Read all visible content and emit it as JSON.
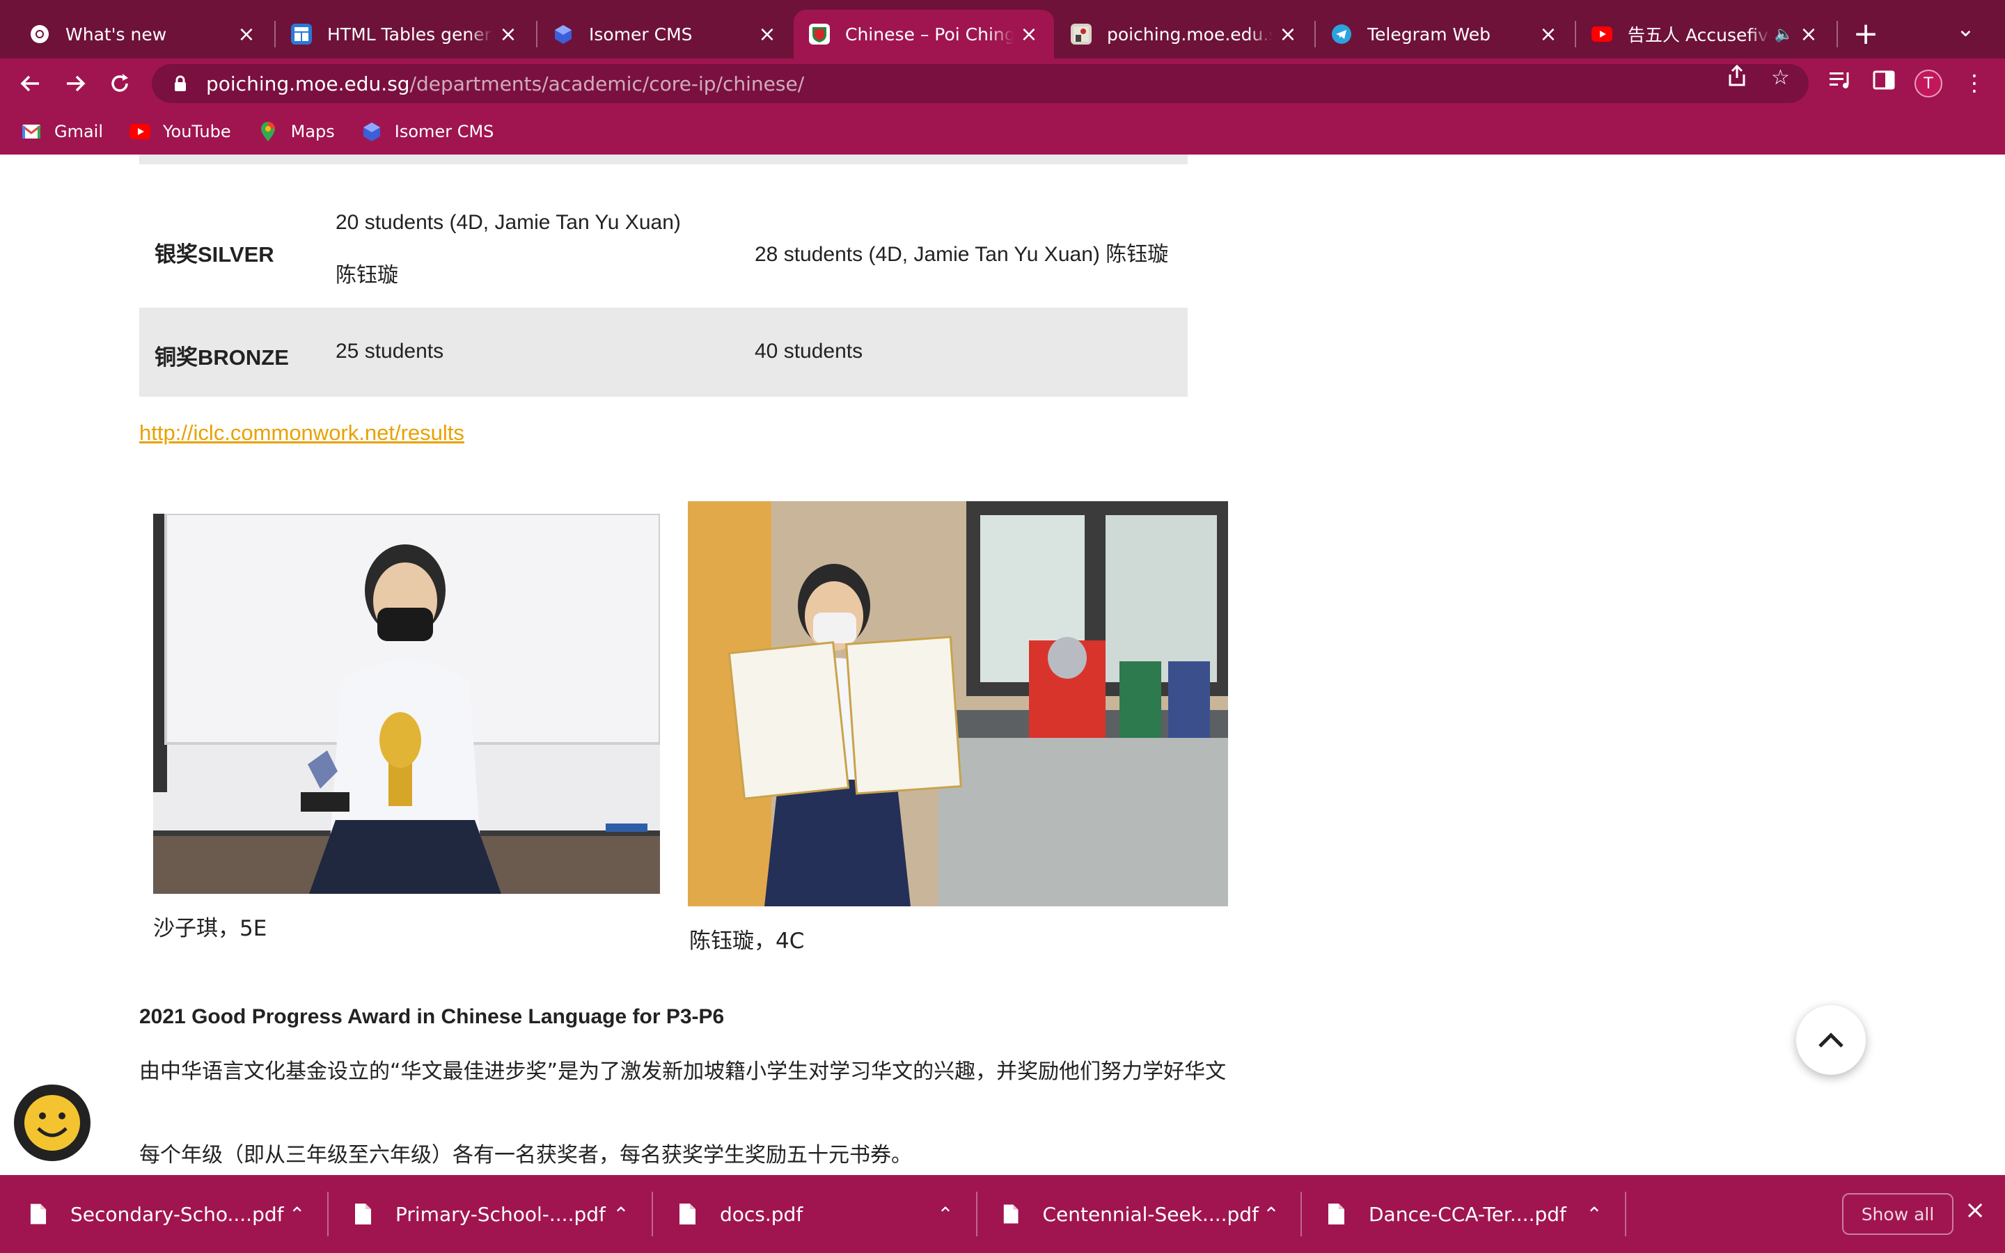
{
  "browser": {
    "tabs": [
      {
        "title": "What's new",
        "icon": "chrome-icon"
      },
      {
        "title": "HTML Tables generator",
        "icon": "tables-generator-icon"
      },
      {
        "title": "Isomer CMS",
        "icon": "isomer-icon"
      },
      {
        "title": "Chinese – Poi Ching School",
        "icon": "school-crest-icon",
        "active": true
      },
      {
        "title": "poiching.moe.edu.sg",
        "icon": "site-image-icon"
      },
      {
        "title": "Telegram Web",
        "icon": "telegram-icon"
      },
      {
        "title": "告五人 Accusefive",
        "icon": "youtube-icon",
        "audio": true
      }
    ],
    "url_host": "poiching.moe.edu.sg",
    "url_path": "/departments/academic/core-ip/chinese/",
    "profile_initial": "T",
    "bookmarks": [
      {
        "label": "Gmail",
        "icon": "gmail-icon"
      },
      {
        "label": "YouTube",
        "icon": "youtube-icon"
      },
      {
        "label": "Maps",
        "icon": "maps-icon"
      },
      {
        "label": "Isomer CMS",
        "icon": "isomer-icon"
      }
    ],
    "theme_colors": {
      "tab_strip": "#6e1239",
      "toolbar": "#a0154f"
    }
  },
  "content": {
    "table_rows": [
      {
        "award": "银奖SILVER",
        "col2_line1": "20 students (4D, Jamie Tan Yu Xuan)",
        "col2_line2": "陈钰璇",
        "col3": "28 students (4D, Jamie Tan Yu Xuan) 陈钰璇"
      },
      {
        "award": "铜奖BRONZE",
        "col2": "25 students",
        "col3": "40 students"
      }
    ],
    "results_link": "http://iclc.commonwork.net/results",
    "photos": [
      {
        "caption": "沙子琪，5E"
      },
      {
        "caption": "陈钰璇，4C"
      }
    ],
    "award_title": "2021 Good Progress Award in Chinese Language for P3-P6",
    "paragraph1": "由中华语言文化基金设立的“华文最佳进步奖”是为了激发新加坡籍小学生对学习华文的兴趣，并奖励他们努力学好华文",
    "paragraph2": "每个年级（即从三年级至六年级）各有一名获奖者，每名获奖学生奖励五十元书券。",
    "link_color": "#e8a100"
  },
  "downloads": {
    "items": [
      {
        "name": "Secondary-Scho....pdf"
      },
      {
        "name": "Primary-School-....pdf"
      },
      {
        "name": "docs.pdf"
      },
      {
        "name": "Centennial-Seek....pdf"
      },
      {
        "name": "Dance-CCA-Ter....pdf"
      }
    ],
    "show_all": "Show all"
  }
}
